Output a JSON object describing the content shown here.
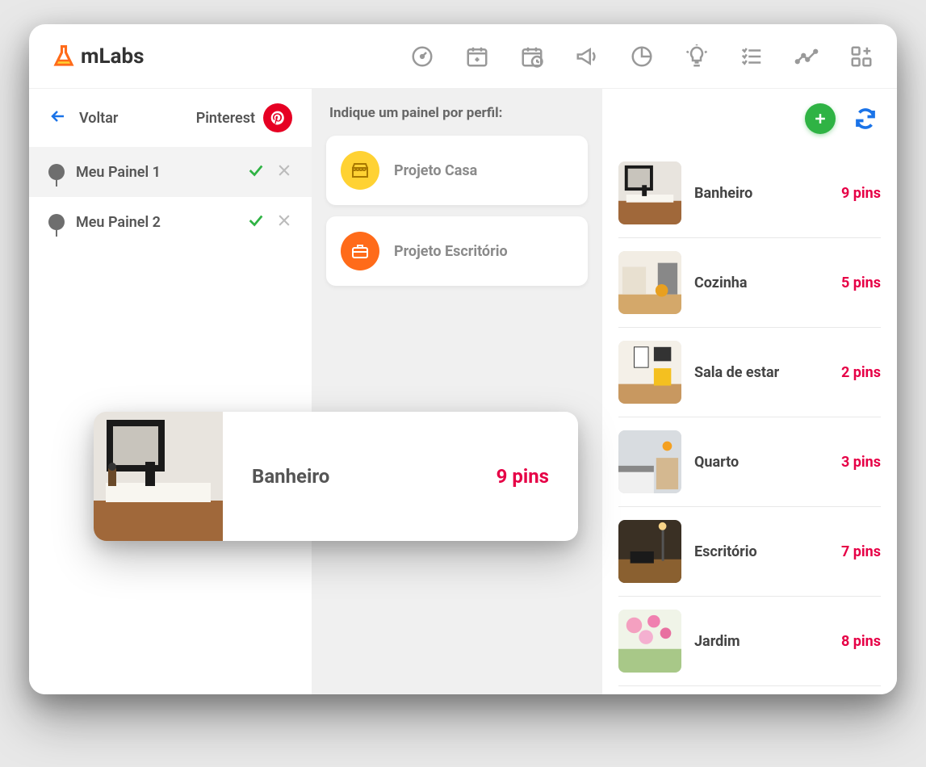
{
  "brand": "mLabs",
  "sidebar": {
    "back_label": "Voltar",
    "network_label": "Pinterest",
    "panels": [
      {
        "label": "Meu Painel 1"
      },
      {
        "label": "Meu Painel 2"
      }
    ]
  },
  "middle": {
    "title": "Indique um painel por perfil:",
    "projects": [
      {
        "label": "Projeto Casa",
        "icon": "storefront",
        "color": "yellow"
      },
      {
        "label": "Projeto Escritório",
        "icon": "briefcase",
        "color": "orange"
      }
    ]
  },
  "right": {
    "boards": [
      {
        "name": "Banheiro",
        "pins": "9 pins"
      },
      {
        "name": "Cozinha",
        "pins": "5 pins"
      },
      {
        "name": "Sala de estar",
        "pins": "2 pins"
      },
      {
        "name": "Quarto",
        "pins": "3 pins"
      },
      {
        "name": "Escritório",
        "pins": "7 pins"
      },
      {
        "name": "Jardim",
        "pins": "8 pins"
      }
    ]
  },
  "featured": {
    "name": "Banheiro",
    "pins": "9 pins"
  }
}
